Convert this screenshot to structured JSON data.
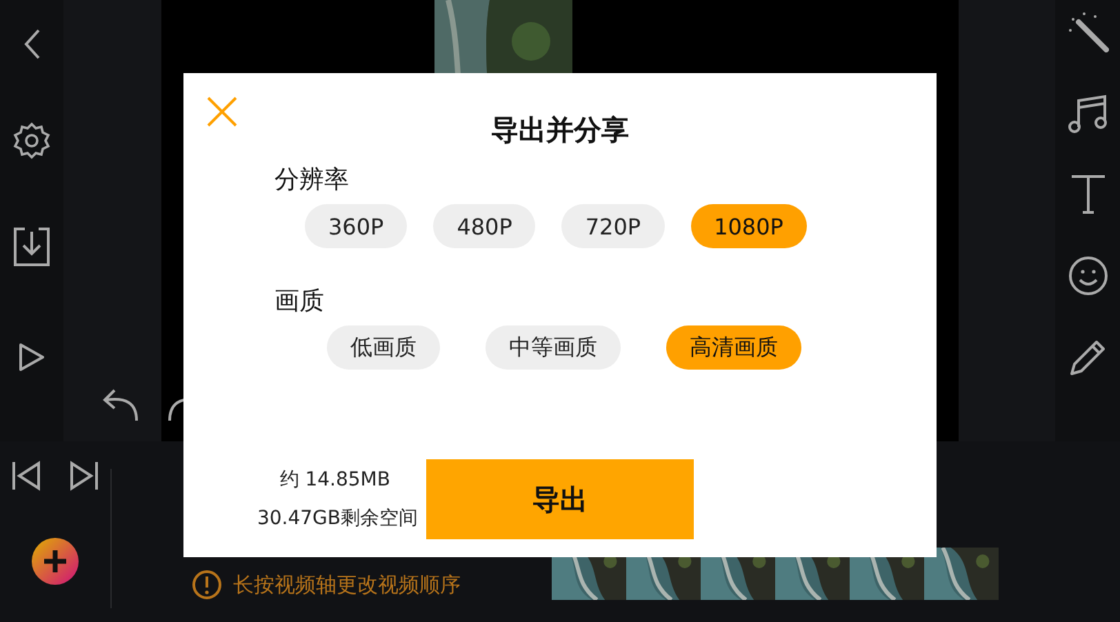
{
  "dialog": {
    "title": "导出并分享",
    "sections": [
      {
        "label": "分辨率",
        "options": [
          {
            "label": "360P",
            "selected": false
          },
          {
            "label": "480P",
            "selected": false
          },
          {
            "label": "720P",
            "selected": false
          },
          {
            "label": "1080P",
            "selected": true
          }
        ]
      },
      {
        "label": "画质",
        "options": [
          {
            "label": "低画质",
            "selected": false
          },
          {
            "label": "中等画质",
            "selected": false
          },
          {
            "label": "高清画质",
            "selected": true
          }
        ]
      }
    ],
    "size_estimate": "约 14.85MB",
    "free_space": "30.47GB剩余空间",
    "export_button": "导出"
  },
  "timeline": {
    "hint": "长按视频轴更改视频顺序"
  }
}
